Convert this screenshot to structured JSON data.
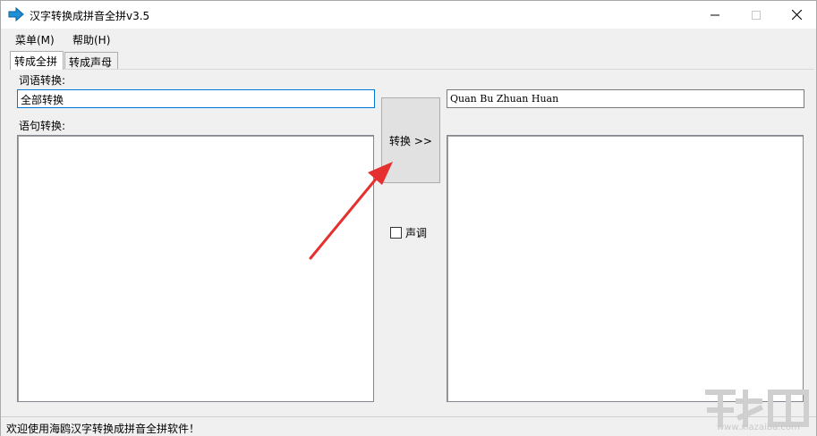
{
  "window": {
    "title": "汉字转换成拼音全拼v3.5",
    "controls": {
      "minimize": "—",
      "maximize": "☐",
      "close": "✕"
    }
  },
  "menu": [
    {
      "label": "菜单(M)"
    },
    {
      "label": "帮助(H)"
    }
  ],
  "tabs": [
    {
      "label": "转成全拼",
      "active": true
    },
    {
      "label": "转成声母",
      "active": false
    }
  ],
  "panel": {
    "word_label": "词语转换:",
    "word_input": "全部转换",
    "sentence_label": "语句转换:",
    "sentence_input": "",
    "convert_button": "转换 >>",
    "tone_checkbox": {
      "label": "声调",
      "checked": false
    },
    "word_output": "Quan Bu Zhuan Huan",
    "sentence_output": ""
  },
  "status": "欢迎使用海鸥汉字转换成拼音全拼软件！",
  "watermark": "www.xiazaiba.com",
  "colors": {
    "accent": "#0078d7",
    "annotation_arrow": "#e53030",
    "app_icon": "#1e90d6"
  }
}
